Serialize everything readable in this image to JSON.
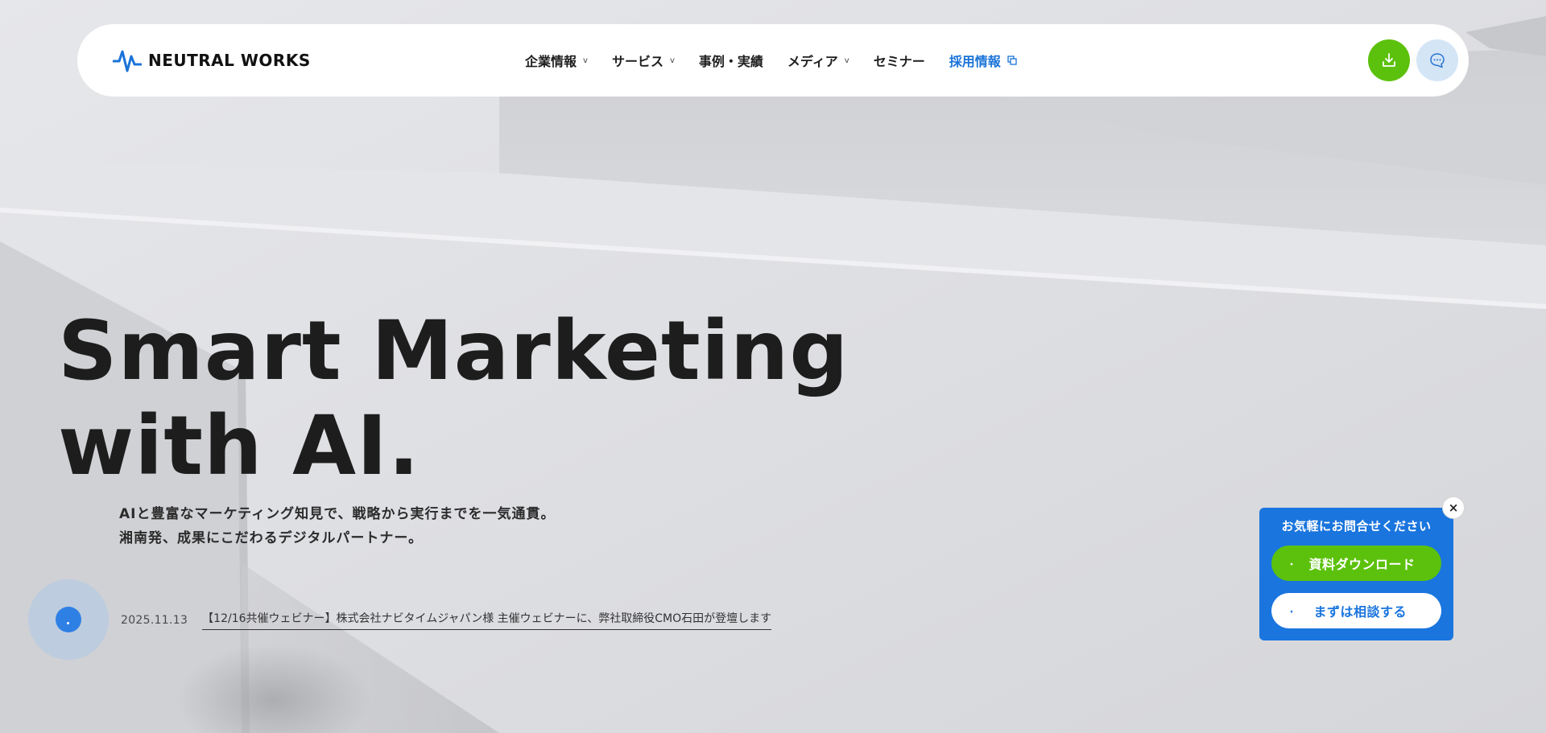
{
  "brand": {
    "name": "NEUTRAL WORKS",
    "logo_icon": "pulse-wave-icon",
    "accent_color": "#1a73d8",
    "green_color": "#5cc10c"
  },
  "nav": {
    "items": [
      {
        "label": "企業情報",
        "has_dropdown": true
      },
      {
        "label": "サービス",
        "has_dropdown": true
      },
      {
        "label": "事例・実績",
        "has_dropdown": false
      },
      {
        "label": "メディア",
        "has_dropdown": true
      },
      {
        "label": "セミナー",
        "has_dropdown": false
      },
      {
        "label": "採用情報",
        "has_dropdown": false,
        "external": true
      }
    ],
    "download_icon": "download-icon",
    "chat_icon": "chat-bubble-icon"
  },
  "hero": {
    "headline_line1": "Smart Marketing",
    "headline_line2": "with AI.",
    "subcopy_line1": "AIと豊富なマーケティング知見で、戦略から実行までを一気通貫。",
    "subcopy_line2": "湘南発、成果にこだわるデジタルパートナー。"
  },
  "news": {
    "date": "2025.11.13",
    "text": "【12/16共催ウェビナー】株式会社ナビタイムジャパン様 主催ウェビナーに、弊社取締役CMO石田が登壇します"
  },
  "contact_widget": {
    "title": "お気軽にお問合せください",
    "download_label": "資料ダウンロード",
    "consult_label": "まずは相談する",
    "close_label": "×"
  }
}
